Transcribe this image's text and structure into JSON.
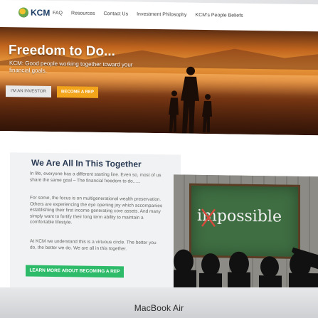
{
  "nav": {
    "logo_text": "KCM",
    "links": [
      "FAQ",
      "Resources",
      "Contact Us",
      "Investment Philosophy",
      "KCM's People Beliefs"
    ]
  },
  "hero": {
    "title": "Freedom to Do...",
    "subtitle": "KCM: Good people working together toward your financial goals.",
    "investor_button": "I'M AN INVESTOR",
    "rep_button": "BECOME A REP"
  },
  "section": {
    "title": "We Are All In This Together",
    "paragraphs": [
      "In life, everyone has a different starting line. Even so, most of us share the same goal – The financial freedom to do......",
      "For some, the focus is on multigenerational wealth preservation. Others are experiencing the eye opening joy which accompanies establishing their first income generating core assets. And many simply want to fortify their long term ability to maintain a comfortable lifestyle.",
      "At KCM we understand this is a virtuous circle. The better you do, the better we do. We are all in this together."
    ],
    "learn_button": "LEARN MORE ABOUT BECOMING A REP"
  },
  "photo": {
    "board_text": "impossible"
  },
  "device": {
    "label": "MacBook Air"
  },
  "colors": {
    "accent_orange": "#f2a51b",
    "accent_green": "#2dbb6a",
    "heading_navy": "#2a3b55"
  }
}
